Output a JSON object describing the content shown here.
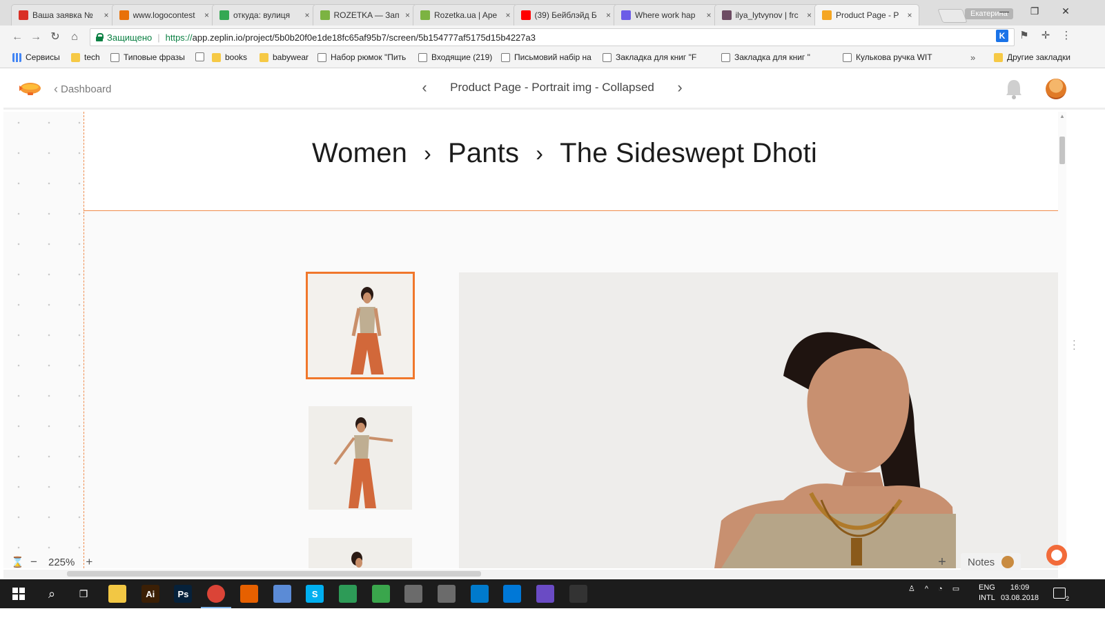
{
  "browser": {
    "tabs": [
      {
        "title": "Ваша заявка №",
        "favicon_color": "#d93025"
      },
      {
        "title": "www.logocontest",
        "favicon_color": "#e8710a"
      },
      {
        "title": "откуда: вулиця",
        "favicon_color": "#34a853"
      },
      {
        "title": "ROZETKA — Зап",
        "favicon_color": "#7cb342"
      },
      {
        "title": "Rozetka.ua | Ape",
        "favicon_color": "#7cb342"
      },
      {
        "title": "(39) Бейблэйд Б",
        "favicon_color": "#ff0000"
      },
      {
        "title": "Where work hap",
        "favicon_color": "#6c5ce7"
      },
      {
        "title": "ilya_lytvynov | frc",
        "favicon_color": "#6d4c63"
      },
      {
        "title": "Product Page - P",
        "favicon_color": "#f5a623",
        "active": true
      }
    ],
    "tab_close": "×",
    "profile_name": "Екатерина",
    "window_controls": {
      "minimize": "—",
      "restore": "❐",
      "close": "✕"
    },
    "nav": {
      "back": "←",
      "forward": "→",
      "reload": "↻",
      "home": "⌂"
    },
    "secure_label": "Защищено",
    "url_proto": "https://",
    "url_rest": "app.zeplin.io/project/5b0b20f0e1de18fc65af95b7/screen/5b154777af5175d15b4227a3",
    "star": "☆",
    "menu": "⋮",
    "bookmarks": [
      {
        "label": "Сервисы",
        "kind": "apps"
      },
      {
        "label": "tech",
        "kind": "folder"
      },
      {
        "label": "Типовые фразы",
        "kind": "page"
      },
      {
        "label": "",
        "kind": "page"
      },
      {
        "label": "books",
        "kind": "folder"
      },
      {
        "label": "babywear",
        "kind": "folder"
      },
      {
        "label": "Набор рюмок \"Пить",
        "kind": "page"
      },
      {
        "label": "Входящие (219)",
        "kind": "page"
      },
      {
        "label": "Письмовий набір на",
        "kind": "page"
      },
      {
        "label": "Закладка для книг \"F",
        "kind": "page"
      },
      {
        "label": "Закладка для книг \"",
        "kind": "page"
      },
      {
        "label": "Кулькова ручка WIT",
        "kind": "page"
      }
    ],
    "bookmarks_more": "»",
    "other_bookmarks": "Другие закладки"
  },
  "zeplin": {
    "back_label": "Dashboard",
    "screen_title": "Product Page - Portrait img - Collapsed",
    "prev": "‹",
    "next": "›",
    "zoom": "225%",
    "zoom_minus": "−",
    "zoom_plus": "+",
    "notes_label": "Notes",
    "add_note": "+"
  },
  "design": {
    "breadcrumb": [
      "Women",
      "Pants",
      "The Sideswept Dhoti"
    ],
    "breadcrumb_sep": "›",
    "accent_color": "#f0772b"
  },
  "taskbar": {
    "search": "⌕",
    "task_view": "❐",
    "apps": [
      {
        "name": "file-explorer",
        "label": "",
        "color": "#f2c744"
      },
      {
        "name": "illustrator",
        "label": "Ai",
        "color": "#3b1f05"
      },
      {
        "name": "photoshop",
        "label": "Ps",
        "color": "#06213a"
      },
      {
        "name": "chrome",
        "label": "",
        "color": "#db4437",
        "running": true
      },
      {
        "name": "firefox",
        "label": "",
        "color": "#e66000"
      },
      {
        "name": "browser",
        "label": "",
        "color": "#5b8bd6"
      },
      {
        "name": "skype",
        "label": "S",
        "color": "#00aff0"
      },
      {
        "name": "app-a",
        "label": "",
        "color": "#2d9b57"
      },
      {
        "name": "app-b",
        "label": "",
        "color": "#3aa64c"
      },
      {
        "name": "git-a",
        "label": "",
        "color": "#6b6b6b"
      },
      {
        "name": "git-b",
        "label": "",
        "color": "#6b6b6b"
      },
      {
        "name": "vscode",
        "label": "",
        "color": "#007acc"
      },
      {
        "name": "store",
        "label": "",
        "color": "#0078d7"
      },
      {
        "name": "app-c",
        "label": "",
        "color": "#6a4bc4"
      },
      {
        "name": "photos",
        "label": "",
        "color": "#333333"
      }
    ],
    "lang_top": "ENG",
    "lang_bottom": "INTL",
    "time": "16:09",
    "date": "03.08.2018",
    "notifications_count": "2"
  }
}
